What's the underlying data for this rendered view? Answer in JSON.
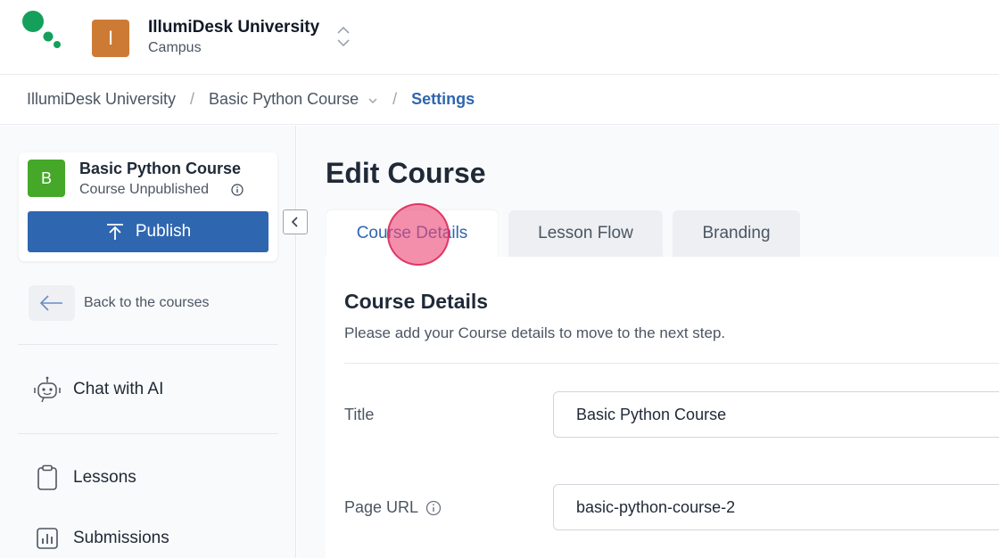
{
  "header": {
    "org_initial": "I",
    "org_name": "IllumiDesk University",
    "org_sub": "Campus"
  },
  "breadcrumb": {
    "items": [
      "IllumiDesk University",
      "Basic Python Course",
      "Settings"
    ],
    "separator": "/"
  },
  "sidebar": {
    "course_initial": "B",
    "course_title": "Basic Python Course",
    "course_status": "Course Unpublished",
    "publish_label": "Publish",
    "back_label": "Back to the courses",
    "nav": [
      {
        "label": "Chat with AI",
        "icon": "robot-icon"
      },
      {
        "label": "Lessons",
        "icon": "clipboard-icon"
      },
      {
        "label": "Submissions",
        "icon": "bar-chart-icon"
      }
    ]
  },
  "main": {
    "title": "Edit Course",
    "tabs": [
      {
        "label": "Course Details",
        "active": true
      },
      {
        "label": "Lesson Flow",
        "active": false
      },
      {
        "label": "Branding",
        "active": false
      }
    ],
    "section_title": "Course Details",
    "section_desc": "Please add your Course details to move to the next step.",
    "fields": {
      "title_label": "Title",
      "title_value": "Basic Python Course",
      "url_label": "Page URL",
      "url_value": "basic-python-course-2"
    }
  },
  "colors": {
    "brand_blue": "#2f66b0",
    "logo_green": "#14a05a",
    "org_badge": "#cd7a35",
    "course_badge": "#45a829"
  }
}
